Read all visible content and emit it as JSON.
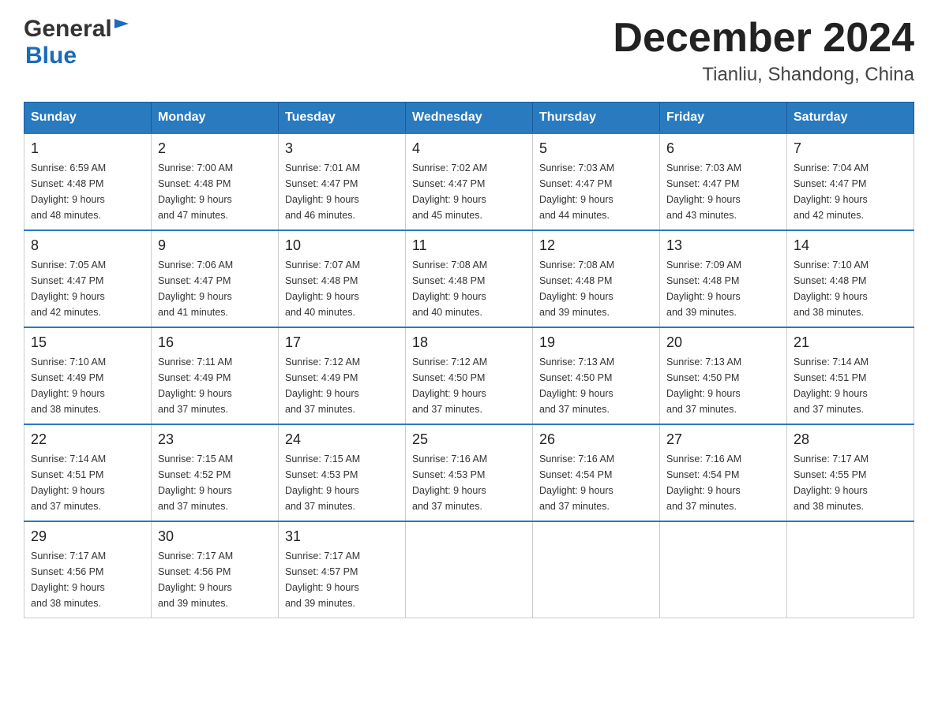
{
  "header": {
    "logo_general": "General",
    "logo_blue": "Blue",
    "month_title": "December 2024",
    "location": "Tianliu, Shandong, China"
  },
  "weekdays": [
    "Sunday",
    "Monday",
    "Tuesday",
    "Wednesday",
    "Thursday",
    "Friday",
    "Saturday"
  ],
  "weeks": [
    [
      {
        "day": "1",
        "sunrise": "6:59 AM",
        "sunset": "4:48 PM",
        "daylight": "9 hours and 48 minutes."
      },
      {
        "day": "2",
        "sunrise": "7:00 AM",
        "sunset": "4:48 PM",
        "daylight": "9 hours and 47 minutes."
      },
      {
        "day": "3",
        "sunrise": "7:01 AM",
        "sunset": "4:47 PM",
        "daylight": "9 hours and 46 minutes."
      },
      {
        "day": "4",
        "sunrise": "7:02 AM",
        "sunset": "4:47 PM",
        "daylight": "9 hours and 45 minutes."
      },
      {
        "day": "5",
        "sunrise": "7:03 AM",
        "sunset": "4:47 PM",
        "daylight": "9 hours and 44 minutes."
      },
      {
        "day": "6",
        "sunrise": "7:03 AM",
        "sunset": "4:47 PM",
        "daylight": "9 hours and 43 minutes."
      },
      {
        "day": "7",
        "sunrise": "7:04 AM",
        "sunset": "4:47 PM",
        "daylight": "9 hours and 42 minutes."
      }
    ],
    [
      {
        "day": "8",
        "sunrise": "7:05 AM",
        "sunset": "4:47 PM",
        "daylight": "9 hours and 42 minutes."
      },
      {
        "day": "9",
        "sunrise": "7:06 AM",
        "sunset": "4:47 PM",
        "daylight": "9 hours and 41 minutes."
      },
      {
        "day": "10",
        "sunrise": "7:07 AM",
        "sunset": "4:48 PM",
        "daylight": "9 hours and 40 minutes."
      },
      {
        "day": "11",
        "sunrise": "7:08 AM",
        "sunset": "4:48 PM",
        "daylight": "9 hours and 40 minutes."
      },
      {
        "day": "12",
        "sunrise": "7:08 AM",
        "sunset": "4:48 PM",
        "daylight": "9 hours and 39 minutes."
      },
      {
        "day": "13",
        "sunrise": "7:09 AM",
        "sunset": "4:48 PM",
        "daylight": "9 hours and 39 minutes."
      },
      {
        "day": "14",
        "sunrise": "7:10 AM",
        "sunset": "4:48 PM",
        "daylight": "9 hours and 38 minutes."
      }
    ],
    [
      {
        "day": "15",
        "sunrise": "7:10 AM",
        "sunset": "4:49 PM",
        "daylight": "9 hours and 38 minutes."
      },
      {
        "day": "16",
        "sunrise": "7:11 AM",
        "sunset": "4:49 PM",
        "daylight": "9 hours and 37 minutes."
      },
      {
        "day": "17",
        "sunrise": "7:12 AM",
        "sunset": "4:49 PM",
        "daylight": "9 hours and 37 minutes."
      },
      {
        "day": "18",
        "sunrise": "7:12 AM",
        "sunset": "4:50 PM",
        "daylight": "9 hours and 37 minutes."
      },
      {
        "day": "19",
        "sunrise": "7:13 AM",
        "sunset": "4:50 PM",
        "daylight": "9 hours and 37 minutes."
      },
      {
        "day": "20",
        "sunrise": "7:13 AM",
        "sunset": "4:50 PM",
        "daylight": "9 hours and 37 minutes."
      },
      {
        "day": "21",
        "sunrise": "7:14 AM",
        "sunset": "4:51 PM",
        "daylight": "9 hours and 37 minutes."
      }
    ],
    [
      {
        "day": "22",
        "sunrise": "7:14 AM",
        "sunset": "4:51 PM",
        "daylight": "9 hours and 37 minutes."
      },
      {
        "day": "23",
        "sunrise": "7:15 AM",
        "sunset": "4:52 PM",
        "daylight": "9 hours and 37 minutes."
      },
      {
        "day": "24",
        "sunrise": "7:15 AM",
        "sunset": "4:53 PM",
        "daylight": "9 hours and 37 minutes."
      },
      {
        "day": "25",
        "sunrise": "7:16 AM",
        "sunset": "4:53 PM",
        "daylight": "9 hours and 37 minutes."
      },
      {
        "day": "26",
        "sunrise": "7:16 AM",
        "sunset": "4:54 PM",
        "daylight": "9 hours and 37 minutes."
      },
      {
        "day": "27",
        "sunrise": "7:16 AM",
        "sunset": "4:54 PM",
        "daylight": "9 hours and 37 minutes."
      },
      {
        "day": "28",
        "sunrise": "7:17 AM",
        "sunset": "4:55 PM",
        "daylight": "9 hours and 38 minutes."
      }
    ],
    [
      {
        "day": "29",
        "sunrise": "7:17 AM",
        "sunset": "4:56 PM",
        "daylight": "9 hours and 38 minutes."
      },
      {
        "day": "30",
        "sunrise": "7:17 AM",
        "sunset": "4:56 PM",
        "daylight": "9 hours and 39 minutes."
      },
      {
        "day": "31",
        "sunrise": "7:17 AM",
        "sunset": "4:57 PM",
        "daylight": "9 hours and 39 minutes."
      },
      null,
      null,
      null,
      null
    ]
  ],
  "labels": {
    "sunrise": "Sunrise:",
    "sunset": "Sunset:",
    "daylight": "Daylight:"
  }
}
